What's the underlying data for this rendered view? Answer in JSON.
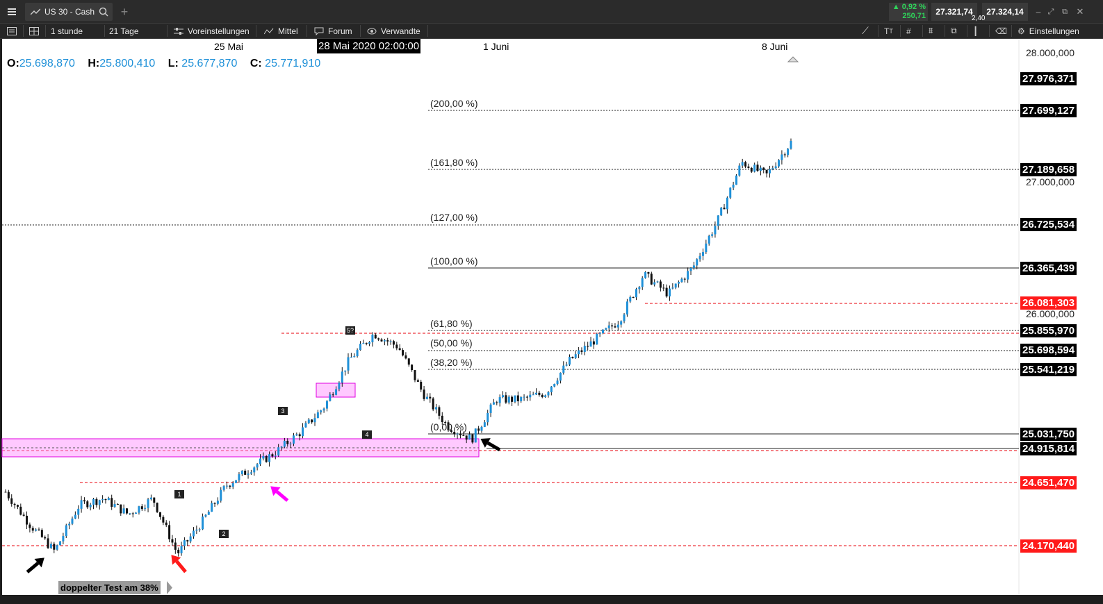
{
  "topbar": {
    "tab_title": "US 30 - Cash",
    "change_pct": "0,92 %",
    "change_abs": "250,71",
    "bid": "27.321,74",
    "spread": "2,40",
    "ask": "27.324,14"
  },
  "toolbar": {
    "timeframe": "1 stunde",
    "range": "21 Tage",
    "presets": "Voreinstellungen",
    "indicator": "Mittel",
    "forum": "Forum",
    "related": "Verwandte",
    "settings": "Einstellungen"
  },
  "ohlc": {
    "o_label": "O:",
    "o": "25.698,870",
    "h_label": "H:",
    "h": "25.800,410",
    "l_label": "L:",
    "l": "25.677,870",
    "c_label": "C:",
    "c": "25.771,910"
  },
  "dates": {
    "d1": "25 Mai",
    "d2": "28 Mai 2020 02:00:00",
    "d3": "1 Juni",
    "d4": "8 Juni"
  },
  "price_axis": {
    "p28000": "28.000,000",
    "current": "27.976,371",
    "p27000": "27.000,000",
    "p26000": "26.000,000"
  },
  "levels": {
    "l200": "27.699,127",
    "l161": "27.189,658",
    "l127": "26.725,534",
    "l100": "26.365,439",
    "red1": "26.081,303",
    "l618": "25.855,970",
    "l50": "25.698,594",
    "l382": "25.541,219",
    "l0": "25.031,750",
    "blk": "24.915,814",
    "red2": "24.651,470",
    "red3": "24.170,440"
  },
  "fib_labels": {
    "f200": "(200,00 %)",
    "f161": "(161,80 %)",
    "f127": "(127,00 %)",
    "f100": "(100,00 %)",
    "f618": "(61,80 %)",
    "f50": "(50,00 %)",
    "f382": "(38,20 %)",
    "f0": "(0,00 %)"
  },
  "markers": {
    "m1": "1",
    "m2": "2",
    "m3": "3",
    "m4": "4",
    "m5": "5?"
  },
  "note": "doppelter Test am 38%",
  "colors": {
    "candle": "#1e90d8",
    "fib_red": "#e8000b",
    "zone": "#ff88ff",
    "positive": "#2fd35a"
  },
  "chart_data": {
    "type": "candlestick",
    "timeframe": "1 stunde",
    "x_ticks": [
      "25 Mai",
      "1 Juni",
      "8 Juni"
    ],
    "y_ticks": [
      26000,
      27000,
      28000
    ],
    "approx_close_path": [
      24650,
      24400,
      24200,
      24550,
      24600,
      24480,
      24600,
      24180,
      24420,
      24700,
      24830,
      24950,
      25100,
      25300,
      25650,
      25850,
      25750,
      25400,
      25150,
      25050,
      25350,
      25350,
      25400,
      25650,
      25800,
      25950,
      26300,
      26150,
      26350,
      26700,
      27150,
      27050,
      27300
    ]
  }
}
